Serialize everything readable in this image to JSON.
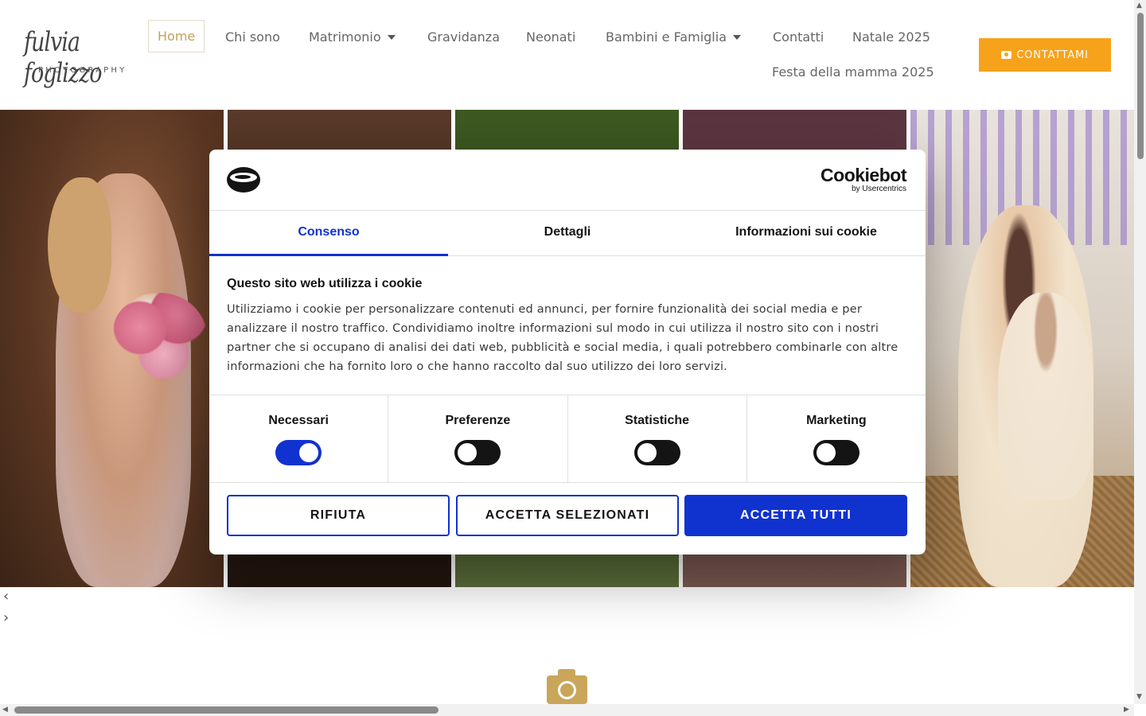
{
  "header": {
    "logo": {
      "script": "fulvia foglizzo",
      "sub": "PHOTOGRAPHY"
    },
    "nav": [
      {
        "label": "Home",
        "active": true
      },
      {
        "label": "Chi sono"
      },
      {
        "label": "Matrimonio",
        "dropdown": true
      },
      {
        "label": "Gravidanza"
      },
      {
        "label": "Neonati"
      },
      {
        "label": "Bambini e Famiglia",
        "dropdown": true
      },
      {
        "label": "Contatti"
      },
      {
        "label": "Natale 2025"
      },
      {
        "label": "Festa della mamma 2025"
      }
    ],
    "cta": {
      "label": "CONTATTAMI",
      "icon": "camera-icon"
    }
  },
  "gallery": {
    "prev_icon": "chevron-left-icon",
    "next_icon": "chevron-right-icon",
    "prev_glyph": "‹",
    "next_glyph": "›"
  },
  "cookie_dialog": {
    "brand": {
      "name": "Cookiebot",
      "by": "by Usercentrics"
    },
    "tabs": [
      "Consenso",
      "Dettagli",
      "Informazioni sui cookie"
    ],
    "active_tab": "Consenso",
    "title": "Questo sito web utilizza i cookie",
    "body": "Utilizziamo i cookie per personalizzare contenuti ed annunci, per fornire funzionalità dei social media e per analizzare il nostro traffico. Condividiamo inoltre informazioni sul modo in cui utilizza il nostro sito con i nostri partner che si occupano di analisi dei dati web, pubblicità e social media, i quali potrebbero combinarle con altre informazioni che ha fornito loro o che hanno raccolto dal suo utilizzo dei loro servizi.",
    "categories": [
      {
        "label": "Necessari",
        "enabled": true
      },
      {
        "label": "Preferenze",
        "enabled": false
      },
      {
        "label": "Statistiche",
        "enabled": false
      },
      {
        "label": "Marketing",
        "enabled": false
      }
    ],
    "buttons": {
      "reject": "RIFIUTA",
      "accept_selected": "ACCETTA SELEZIONATI",
      "accept_all": "ACCETTA TUTTI"
    }
  },
  "colors": {
    "accent_orange": "#f7a21b",
    "cookiebot_blue": "#1032cf",
    "gold": "#c9a65a"
  }
}
